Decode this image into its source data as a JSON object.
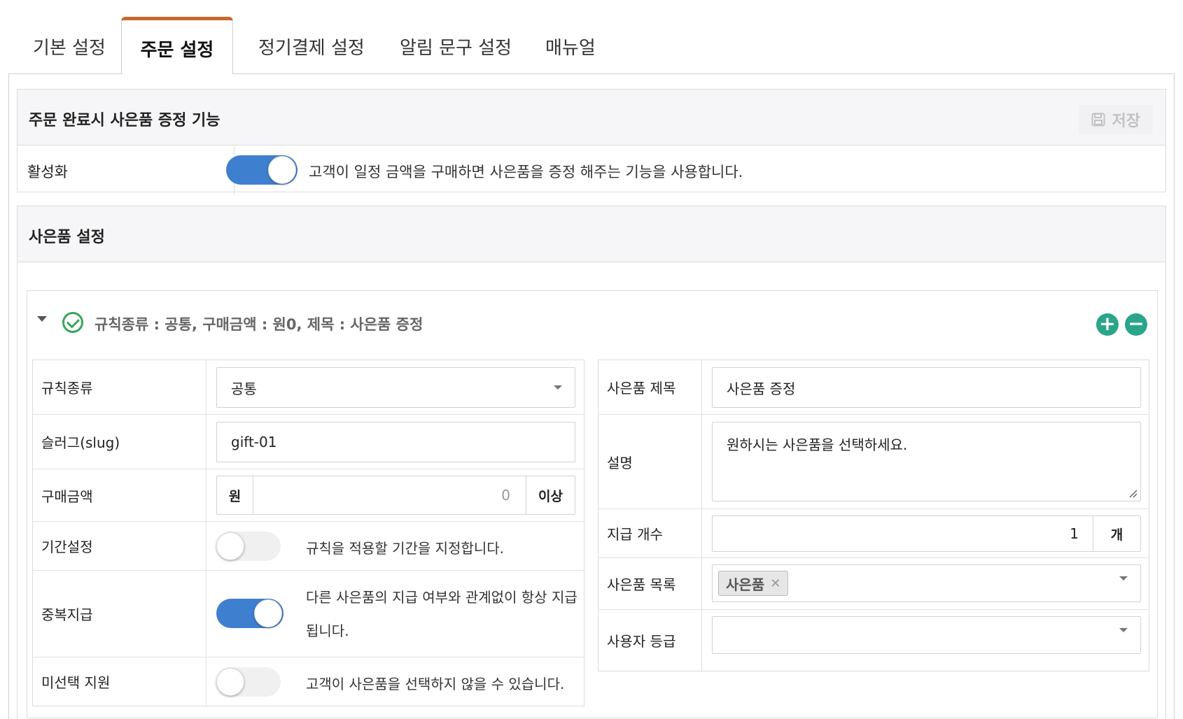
{
  "tabs": [
    {
      "label": "기본 설정"
    },
    {
      "label": "주문 설정"
    },
    {
      "label": "정기결제 설정"
    },
    {
      "label": "알림 문구 설정"
    },
    {
      "label": "매뉴얼"
    }
  ],
  "gift_feature": {
    "title": "주문 완료시 사은품 증정 기능",
    "save_label": "저장",
    "activate_label": "활성화",
    "activate_on": true,
    "activate_desc": "고객이 일정 금액을 구매하면 사은품을 증정 해주는 기능을 사용합니다."
  },
  "gift_settings": {
    "title": "사은품 설정",
    "rule_summary": "규칙종류 : 공통, 구매금액 : 원0, 제목 : 사은품 증정",
    "left": {
      "rule_type_label": "규칙종류",
      "rule_type_value": "공통",
      "slug_label": "슬러그(slug)",
      "slug_value": "gift-01",
      "amount_label": "구매금액",
      "amount_prefix": "원",
      "amount_value": "0",
      "amount_suffix": "이상",
      "period_label": "기간설정",
      "period_on": false,
      "period_desc": "규칙을 적용할 기간을 지정합니다.",
      "dup_label": "중복지급",
      "dup_on": true,
      "dup_desc_line1": "다른 사은품의 지급 여부와 관계없이 항상 지급",
      "dup_desc_line2": "됩니다.",
      "unselect_label": "미선택 지원",
      "unselect_on": false,
      "unselect_desc": "고객이 사은품을 선택하지 않을 수 있습니다."
    },
    "right": {
      "gift_title_label": "사은품 제목",
      "gift_title_value": "사은품 증정",
      "desc_label": "설명",
      "desc_value": "원하시는 사은품을 선택하세요.",
      "count_label": "지급 개수",
      "count_value": "1",
      "count_suffix": "개",
      "list_label": "사은품 목록",
      "list_tag": "사은품",
      "grade_label": "사용자 등급",
      "grade_value": ""
    }
  },
  "colors": {
    "accent_tab": "#c8692c",
    "toggle_on": "#3f7fd0",
    "success": "#3aa55a",
    "action": "#2aa589"
  }
}
